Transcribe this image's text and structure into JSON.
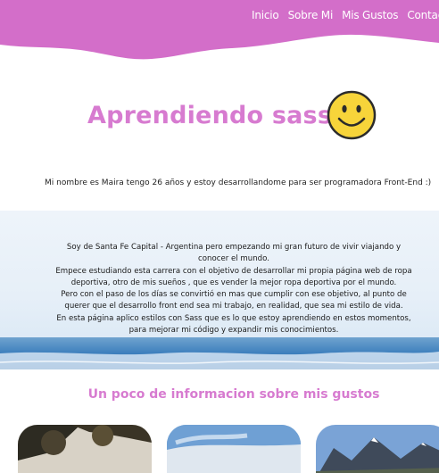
{
  "nav": {
    "items": [
      "Inicio",
      "Sobre Mi",
      "Mis Gustos",
      "Contacto"
    ]
  },
  "hero": {
    "title": "Aprendiendo sass",
    "smiley_icon": "smiley-face-icon"
  },
  "intro": {
    "text": "Mi nombre es Maira tengo 26 años y estoy desarrollandome para ser programadora Front-End :)"
  },
  "bio": {
    "lines": [
      "Soy de Santa Fe Capital - Argentina pero empezando mi gran futuro de vivir viajando y conocer el mundo.",
      "Empece estudiando esta carrera con el objetivo de desarrollar mi propia página web de ropa deportiva, otro de mis sueños , que es vender la mejor ropa deportiva por el mundo.",
      "Pero con el paso de los días se convirtió en mas que cumplir con ese objetivo, al punto de querer que el desarrollo front end sea mi trabajo, en realidad, que sea mi estilo de vida.",
      "En esta página aplico estilos con Sass que es lo que estoy aprendiendo en estos momentos, para mejorar mi código y expandir mis conocimientos."
    ]
  },
  "interests": {
    "title": "Un poco de informacion sobre mis gustos"
  },
  "colors": {
    "brand_pink": "#d77bd0",
    "header_pink": "#d36ec9"
  }
}
